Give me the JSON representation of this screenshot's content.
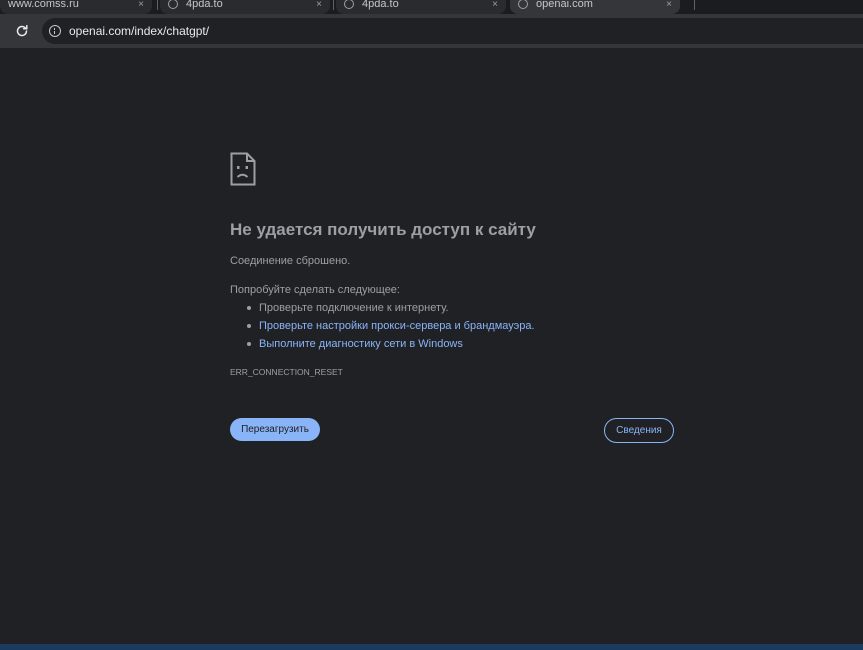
{
  "tabs": [
    {
      "title": "www.comss.ru",
      "active": false
    },
    {
      "title": "4pda.to",
      "active": false
    },
    {
      "title": "4pda.to",
      "active": false
    },
    {
      "title": "openai.com",
      "active": true
    }
  ],
  "tab_close_glyph": "×",
  "address_bar": {
    "url": "openai.com/index/chatgpt/",
    "reload_icon": "reload-icon",
    "info_icon": "info-icon"
  },
  "error_page": {
    "icon": "sad-page-icon",
    "heading": "Не удается получить доступ к сайту",
    "subtext": "Соединение сброшено.",
    "suggestions_title": "Попробуйте сделать следующее:",
    "suggestions": [
      {
        "text": "Проверьте подключение к интернету.",
        "link": false
      },
      {
        "text": "Проверьте настройки прокси-сервера и брандмауэра.",
        "link": true
      },
      {
        "text": "Выполните диагностику сети в Windows",
        "link": true
      }
    ],
    "error_code": "ERR_CONNECTION_RESET",
    "reload_button": "Перезагрузить",
    "details_button": "Сведения"
  },
  "colors": {
    "page_background": "#202124",
    "toolbar_background": "#35363a",
    "text": "#9aa0a6",
    "link": "#8ab4f8",
    "button_primary": "#8ab4f8"
  }
}
